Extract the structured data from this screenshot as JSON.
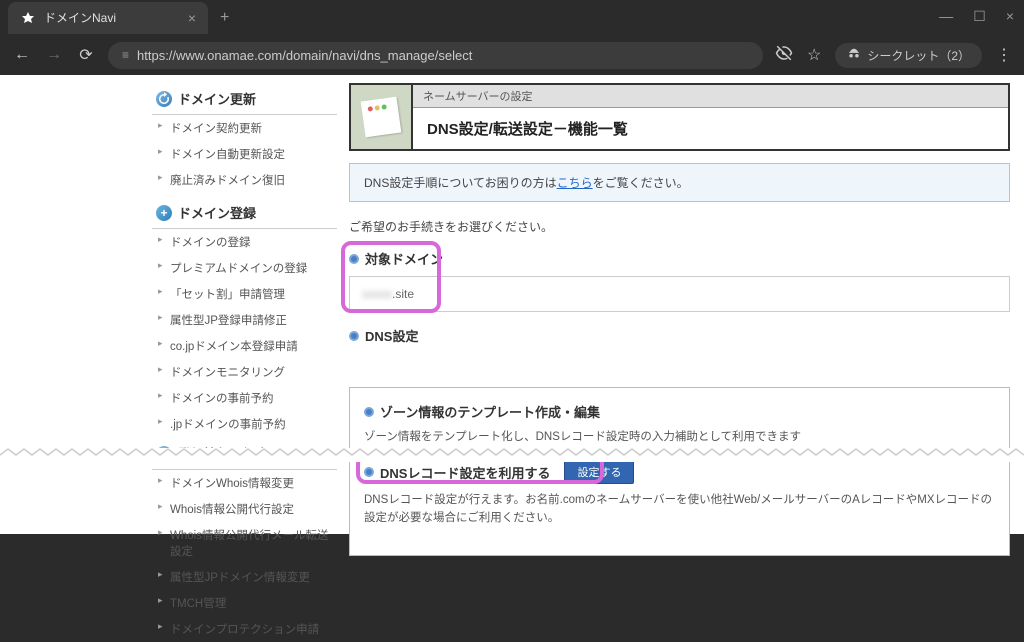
{
  "browser": {
    "tab_title": "ドメインNavi",
    "url": "https://www.onamae.com/domain/navi/dns_manage/select",
    "incognito_label": "シークレット（2）"
  },
  "sidebar": {
    "section1": {
      "title": "ドメイン更新",
      "items": [
        "ドメイン契約更新",
        "ドメイン自動更新設定",
        "廃止済みドメイン復旧"
      ]
    },
    "section2": {
      "title": "ドメイン登録",
      "items": [
        "ドメインの登録",
        "プレミアムドメインの登録",
        "「セット割」申請管理",
        "属性型JP登録申請修正",
        "co.jpドメイン本登録申請",
        "ドメインモニタリング",
        "ドメインの事前予約",
        ".jpドメインの事前予約"
      ]
    },
    "section3": {
      "title": "登録情報の設定",
      "items": [
        "ドメインWhois情報変更",
        "Whois情報公開代行設定",
        "Whois情報公開代行メール転送設定",
        "属性型JPドメイン情報変更",
        "TMCH管理",
        "ドメインプロテクション申請"
      ]
    }
  },
  "header": {
    "breadcrumb": "ネームサーバーの設定",
    "title": "DNS設定/転送設定－機能一覧"
  },
  "info_box": {
    "prefix": "DNS設定手順についてお困りの方は",
    "link_text": "こちら",
    "suffix": "をご覧ください。"
  },
  "instruction": "ご希望のお手続きをお選びください。",
  "target_domain": {
    "label": "対象ドメイン",
    "value_blur": "xxxxx",
    "value_suffix": ".site"
  },
  "dns_label": "DNS設定",
  "zone": {
    "label": "ゾーン情報のテンプレート作成・編集",
    "desc": "ゾーン情報をテンプレート化し、DNSレコード設定時の入力補助として利用できます"
  },
  "dns_record": {
    "label": "DNSレコード設定を利用する",
    "button": "設定する",
    "desc": "DNSレコード設定が行えます。お名前.comのネームサーバーを使い他社Web/メールサーバーのAレコードやMXレコードの設定が必要な場合にご利用ください。"
  }
}
